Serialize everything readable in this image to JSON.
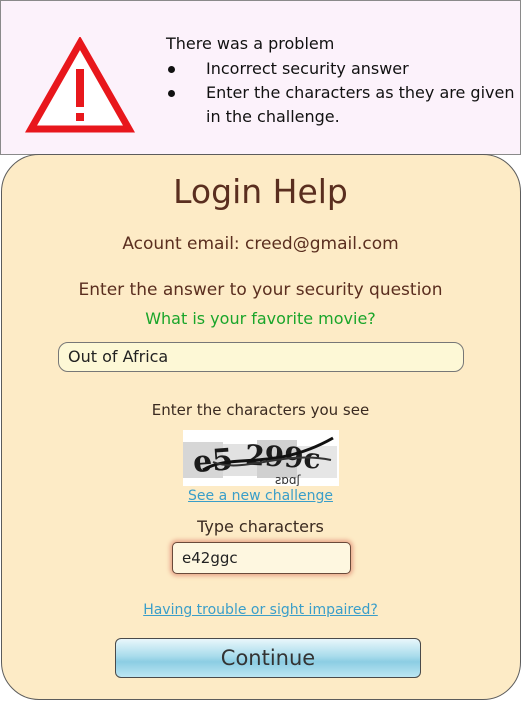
{
  "error": {
    "icon": "warning-triangle-icon",
    "icon_color": "#e8171c",
    "title": "There was a problem",
    "items": [
      "Incorrect security answer",
      "Enter the characters as they are given in the challenge."
    ]
  },
  "form": {
    "title": "Login Help",
    "email_line": "Acount email: creed@gmail.com",
    "answer_prompt": "Enter the answer to your security  question",
    "question": "What is your favorite movie?",
    "answer_value": "Out of Africa",
    "chars_prompt": "Enter the characters you see",
    "captcha_icon": "captcha-image",
    "new_challenge_link": "See a new challenge",
    "type_label": "Type characters",
    "chars_value": "e42ggc",
    "trouble_link": "Having trouble or sight impaired?",
    "continue_label": "Continue"
  },
  "colors": {
    "panel_background": "#fdebc6",
    "error_background": "#fcf2fb",
    "title_text": "#5a2e1f",
    "question_text": "#1aa52a",
    "link": "#3a9ec9"
  }
}
